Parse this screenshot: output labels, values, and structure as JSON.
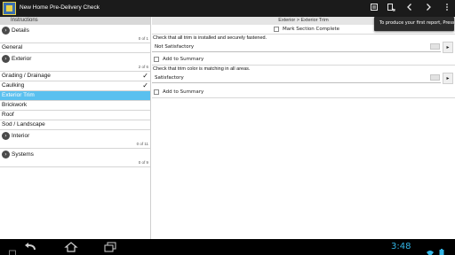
{
  "app": {
    "title": "New Home Pre-Delivery Check"
  },
  "left": {
    "header": "Instructions",
    "groups": [
      {
        "label": "Details",
        "count": "0 of 1"
      },
      {
        "label": "Exterior",
        "count": "2 of 6"
      },
      {
        "label": "Interior",
        "count": "0 of 11"
      },
      {
        "label": "Systems",
        "count": "0 of 9"
      }
    ],
    "general": "General",
    "exterior_items": [
      {
        "label": "Grading / Drainage",
        "checked": true
      },
      {
        "label": "Caulking",
        "checked": true
      },
      {
        "label": "Exterior Trim",
        "checked": false,
        "selected": true
      },
      {
        "label": "Brickwork",
        "checked": false
      },
      {
        "label": "Roof",
        "checked": false
      },
      {
        "label": "Sod / Landscape",
        "checked": false
      }
    ]
  },
  "right": {
    "breadcrumb": "Exterior > Exterior Trim",
    "mark_complete": "Mark Section Complete",
    "items": [
      {
        "question": "Check that all trim is installed and securely fastened.",
        "answer": "Not Satisfactory",
        "add_summary": "Add to Summary"
      },
      {
        "question": "Check that trim color is matching in all areas.",
        "answer": "Satisfactory",
        "add_summary": "Add to Summary"
      }
    ]
  },
  "tooltip": "To produce your first report, Press",
  "status": {
    "time": "3:48"
  },
  "icons": {
    "actionbar": [
      "report-icon",
      "export-icon",
      "previous-icon",
      "next-icon",
      "overflow-menu-icon"
    ],
    "nav": [
      "back-icon",
      "home-icon",
      "recent-apps-icon"
    ]
  }
}
